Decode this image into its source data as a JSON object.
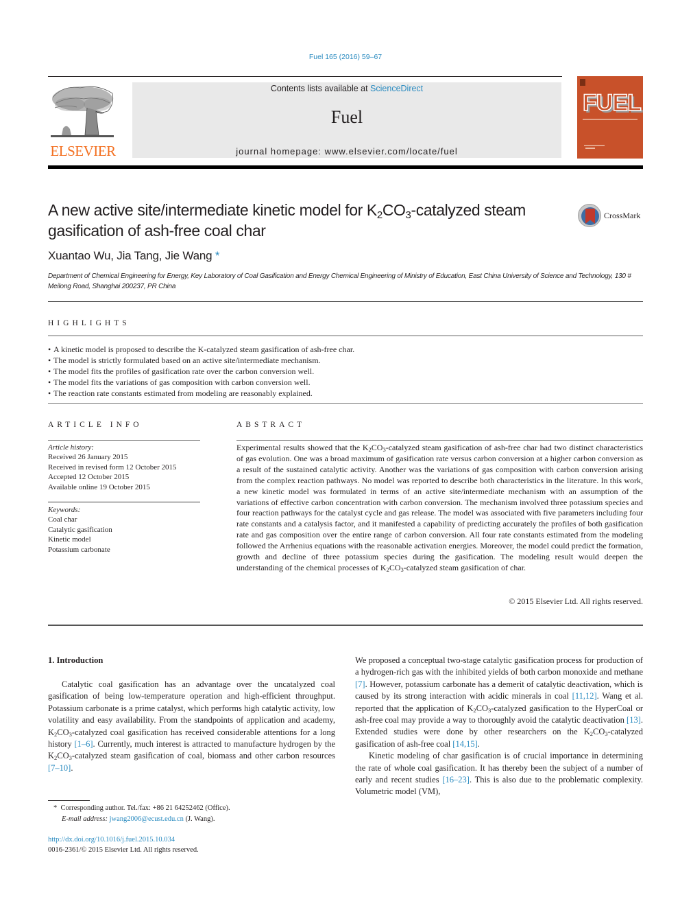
{
  "header": {
    "journal_ref": "Fuel 165 (2016) 59–67",
    "contents_prefix": "Contents lists available at ",
    "contents_link": "ScienceDirect",
    "journal_name": "Fuel",
    "homepage_prefix": "journal homepage: ",
    "homepage_url": "www.elsevier.com/locate/fuel",
    "publisher_logo_text": "ELSEVIER",
    "cover_title": "FUEL",
    "crossmark_label": "CrossMark",
    "colors": {
      "link": "#2a8bc0",
      "elsevier_orange": "#f37021",
      "cover_bg": "#c8512a",
      "masthead_bg": "#e9e9e9"
    }
  },
  "article": {
    "title_part1": "A new active site/intermediate kinetic model for K",
    "title_sub1": "2",
    "title_part2": "CO",
    "title_sub2": "3",
    "title_part3": "-catalyzed steam gasification of ash-free coal char",
    "authors": "Xuantao Wu, Jia Tang, Jie Wang",
    "corresponding_mark": "*",
    "affiliation": "Department of Chemical Engineering for Energy, Key Laboratory of Coal Gasification and Energy Chemical Engineering of Ministry of Education, East China University of Science and Technology, 130 # Meilong Road, Shanghai 200237, PR China"
  },
  "highlights": {
    "heading": "HIGHLIGHTS",
    "items": [
      "A kinetic model is proposed to describe the K-catalyzed steam gasification of ash-free char.",
      "The model is strictly formulated based on an active site/intermediate mechanism.",
      "The model fits the profiles of gasification rate over the carbon conversion well.",
      "The model fits the variations of gas composition with carbon conversion well.",
      "The reaction rate constants estimated from modeling are reasonably explained."
    ]
  },
  "article_info": {
    "heading": "ARTICLE INFO",
    "history_label": "Article history:",
    "history": [
      "Received 26 January 2015",
      "Received in revised form 12 October 2015",
      "Accepted 12 October 2015",
      "Available online 19 October 2015"
    ],
    "keywords_label": "Keywords:",
    "keywords": [
      "Coal char",
      "Catalytic gasification",
      "Kinetic model",
      "Potassium carbonate"
    ]
  },
  "abstract": {
    "heading": "ABSTRACT",
    "p1": "Experimental results showed that the K",
    "p2": "CO",
    "p3": "-catalyzed steam gasification of ash-free char had two distinct characteristics of gas evolution. One was a broad maximum of gasification rate versus carbon conversion at a higher carbon conversion as a result of the sustained catalytic activity. Another was the variations of gas composition with carbon conversion arising from the complex reaction pathways. No model was reported to describe both characteristics in the literature. In this work, a new kinetic model was formulated in terms of an active site/intermediate mechanism with an assumption of the variations of effective carbon concentration with carbon conversion. The mechanism involved three potassium species and four reaction pathways for the catalyst cycle and gas release. The model was associated with five parameters including four rate constants and a catalysis factor, and it manifested a capability of predicting accurately the profiles of both gasification rate and gas composition over the entire range of carbon conversion. All four rate constants estimated from the modeling followed the Arrhenius equations with the reasonable activation energies. Moreover, the model could predict the formation, growth and decline of three potassium species during the gasification. The modeling result would deepen the understanding of the chemical processes of K",
    "p4": "CO",
    "p5": "-catalyzed steam gasification of char.",
    "sub2": "2",
    "sub3": "3",
    "copyright": "© 2015 Elsevier Ltd. All rights reserved."
  },
  "introduction": {
    "heading": "1. Introduction",
    "left": {
      "t1": "Catalytic coal gasification has an advantage over the uncatalyzed coal gasification of being low-temperature operation and high-efficient throughput. Potassium carbonate is a prime catalyst, which performs high catalytic activity, low volatility and easy availability. From the standpoints of application and academy, K",
      "t2": "CO",
      "t3": "-catalyzed coal gasification has received considerable attentions for a long history ",
      "ref1": "[1–6]",
      "t4": ". Currently, much interest is attracted to manufacture hydrogen by the K",
      "t5": "CO",
      "t6": "-catalyzed steam gasification of coal, biomass and other carbon resources ",
      "ref2": "[7–10]",
      "t7": "."
    },
    "right": {
      "t1": "We proposed a conceptual two-stage catalytic gasification process for production of a hydrogen-rich gas with the inhibited yields of both carbon monoxide and methane ",
      "ref1": "[7]",
      "t2": ". However, potassium carbonate has a demerit of catalytic deactivation, which is caused by its strong interaction with acidic minerals in coal ",
      "ref2": "[11,12]",
      "t3": ". Wang et al. reported that the application of K",
      "t4": "CO",
      "t5": "-catalyzed gasification to the HyperCoal or ash-free coal may provide a way to thoroughly avoid the catalytic deactivation ",
      "ref3": "[13]",
      "t6": ". Extended studies were done by other researchers on the K",
      "t7": "CO",
      "t8": "-catalyzed gasification of ash-free coal ",
      "ref4": "[14,15]",
      "t9": ".",
      "p2_t1": "Kinetic modeling of char gasification is of crucial importance in determining the rate of whole coal gasification. It has thereby been the subject of a number of early and recent studies ",
      "p2_ref": "[16–23]",
      "p2_t2": ". This is also due to the problematic complexity. Volumetric model (VM),"
    }
  },
  "footnote": {
    "mark": "*",
    "corresponding": "Corresponding author. Tel./fax: +86 21 64252462 (Office).",
    "email_label": "E-mail address:",
    "email": "jwang2006@ecust.edu.cn",
    "email_suffix": " (J. Wang).",
    "doi": "http://dx.doi.org/10.1016/j.fuel.2015.10.034",
    "issn_copyright": "0016-2361/© 2015 Elsevier Ltd. All rights reserved."
  }
}
